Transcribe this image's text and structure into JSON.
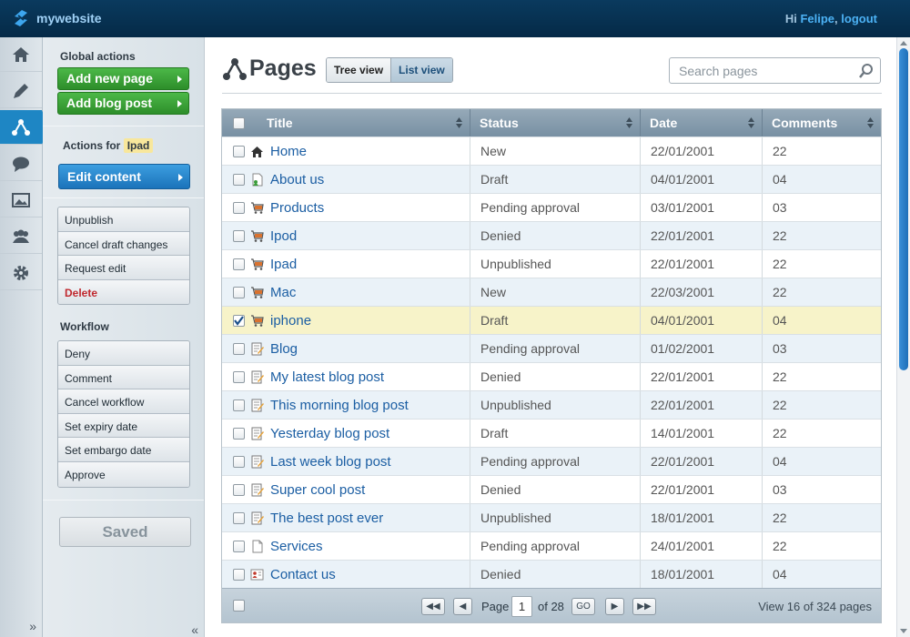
{
  "brand": {
    "name": "mywebsite"
  },
  "user": {
    "greeting": "Hi",
    "name": "Felipe",
    "separator": ",",
    "logout": "logout"
  },
  "rail": {
    "items": [
      "home-icon",
      "pencil-icon",
      "sitemap-icon",
      "comment-icon",
      "image-icon",
      "users-icon",
      "gear-icon"
    ],
    "active_index": 2,
    "expand": "»"
  },
  "global_actions": {
    "title": "Global actions",
    "add_page": "Add new page",
    "add_blog": "Add blog post"
  },
  "actions_for": {
    "label": "Actions for",
    "item": "Ipad",
    "edit": "Edit content"
  },
  "item_actions": [
    "Unpublish",
    "Cancel draft changes",
    "Request edit",
    "Delete"
  ],
  "workflow": {
    "title": "Workflow",
    "items": [
      "Deny",
      "Comment",
      "Cancel workflow",
      "Set expiry date",
      "Set embargo date",
      "Approve"
    ]
  },
  "saved": "Saved",
  "collapse": "«",
  "page": {
    "title": "Pages",
    "tree_view": "Tree view",
    "list_view": "List view",
    "search_placeholder": "Search pages"
  },
  "table": {
    "columns": [
      "Title",
      "Status",
      "Date",
      "Comments"
    ],
    "rows": [
      {
        "icon": "home",
        "title": "Home",
        "status": "New",
        "date": "22/01/2001",
        "comments": "22",
        "checked": false
      },
      {
        "icon": "page-user",
        "title": "About us",
        "status": "Draft",
        "date": "04/01/2001",
        "comments": "04",
        "checked": false
      },
      {
        "icon": "cart",
        "title": "Products",
        "status": "Pending approval",
        "date": "03/01/2001",
        "comments": "03",
        "checked": false
      },
      {
        "icon": "cart",
        "title": "Ipod",
        "status": "Denied",
        "date": "22/01/2001",
        "comments": "22",
        "checked": false
      },
      {
        "icon": "cart",
        "title": "Ipad",
        "status": "Unpublished",
        "date": "22/01/2001",
        "comments": "22",
        "checked": false
      },
      {
        "icon": "cart",
        "title": "Mac",
        "status": "New",
        "date": "22/03/2001",
        "comments": "22",
        "checked": false
      },
      {
        "icon": "cart",
        "title": "iphone",
        "status": "Draft",
        "date": "04/01/2001",
        "comments": "04",
        "checked": true
      },
      {
        "icon": "blog",
        "title": "Blog",
        "status": "Pending approval",
        "date": "01/02/2001",
        "comments": "03",
        "checked": false
      },
      {
        "icon": "blog",
        "title": "My latest blog post",
        "status": "Denied",
        "date": "22/01/2001",
        "comments": "22",
        "checked": false
      },
      {
        "icon": "blog",
        "title": "This morning blog post",
        "status": "Unpublished",
        "date": "22/01/2001",
        "comments": "22",
        "checked": false
      },
      {
        "icon": "blog",
        "title": "Yesterday blog post",
        "status": "Draft",
        "date": "14/01/2001",
        "comments": "22",
        "checked": false
      },
      {
        "icon": "blog",
        "title": "Last week blog post",
        "status": "Pending approval",
        "date": "22/01/2001",
        "comments": "04",
        "checked": false
      },
      {
        "icon": "blog",
        "title": "Super cool post",
        "status": "Denied",
        "date": "22/01/2001",
        "comments": "03",
        "checked": false
      },
      {
        "icon": "blog",
        "title": "The best post ever",
        "status": "Unpublished",
        "date": "18/01/2001",
        "comments": "22",
        "checked": false
      },
      {
        "icon": "page",
        "title": "Services",
        "status": "Pending approval",
        "date": "24/01/2001",
        "comments": "22",
        "checked": false
      },
      {
        "icon": "contact",
        "title": "Contact us",
        "status": "Denied",
        "date": "18/01/2001",
        "comments": "04",
        "checked": false
      }
    ]
  },
  "pagination": {
    "first": "◀◀",
    "prev": "◀",
    "page_label": "Page",
    "current": "1",
    "of": "of 28",
    "go": "GO",
    "next": "▶",
    "last": "▶▶",
    "summary": "View 16 of 324 pages"
  },
  "colors": {
    "accent": "#1e86c4",
    "green": "#3aa336",
    "danger": "#c0282e",
    "selected_row": "#f7f3c9"
  }
}
